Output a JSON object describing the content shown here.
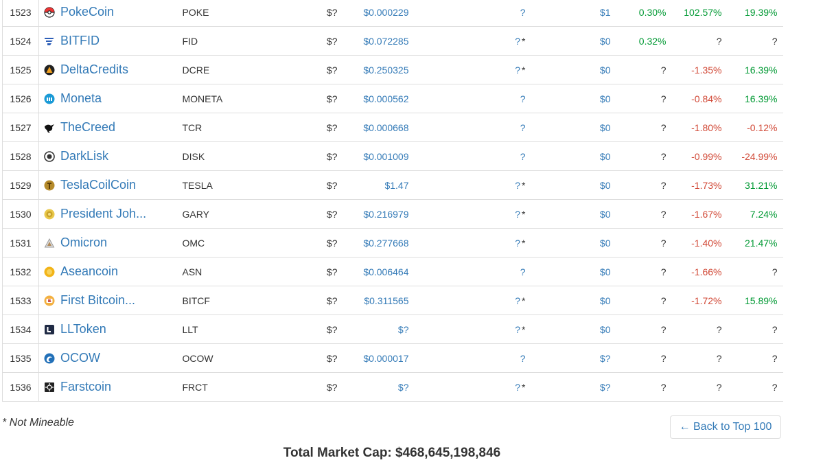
{
  "rows": [
    {
      "rank": "1523",
      "icon": "pokecoin-icon",
      "name": "PokeCoin",
      "symbol": "POKE",
      "market_cap": "$?",
      "price": "$0.000229",
      "supply": "?",
      "mineable": true,
      "volume": "$1",
      "change_1h": "0.30%",
      "change_24h": "102.57%",
      "change_7d": "19.39%"
    },
    {
      "rank": "1524",
      "icon": "bitfid-icon",
      "name": "BITFID",
      "symbol": "FID",
      "market_cap": "$?",
      "price": "$0.072285",
      "supply": "?",
      "mineable": false,
      "volume": "$0",
      "change_1h": "0.32%",
      "change_24h": "?",
      "change_7d": "?"
    },
    {
      "rank": "1525",
      "icon": "deltacredits-icon",
      "name": "DeltaCredits",
      "symbol": "DCRE",
      "market_cap": "$?",
      "price": "$0.250325",
      "supply": "?",
      "mineable": false,
      "volume": "$0",
      "change_1h": "?",
      "change_24h": "-1.35%",
      "change_7d": "16.39%"
    },
    {
      "rank": "1526",
      "icon": "moneta-icon",
      "name": "Moneta",
      "symbol": "MONETA",
      "market_cap": "$?",
      "price": "$0.000562",
      "supply": "?",
      "mineable": true,
      "volume": "$0",
      "change_1h": "?",
      "change_24h": "-0.84%",
      "change_7d": "16.39%"
    },
    {
      "rank": "1527",
      "icon": "thecreed-icon",
      "name": "TheCreed",
      "symbol": "TCR",
      "market_cap": "$?",
      "price": "$0.000668",
      "supply": "?",
      "mineable": true,
      "volume": "$0",
      "change_1h": "?",
      "change_24h": "-1.80%",
      "change_7d": "-0.12%"
    },
    {
      "rank": "1528",
      "icon": "darklisk-icon",
      "name": "DarkLisk",
      "symbol": "DISK",
      "market_cap": "$?",
      "price": "$0.001009",
      "supply": "?",
      "mineable": true,
      "volume": "$0",
      "change_1h": "?",
      "change_24h": "-0.99%",
      "change_7d": "-24.99%"
    },
    {
      "rank": "1529",
      "icon": "teslacoilcoin-icon",
      "name": "TeslaCoilCoin",
      "symbol": "TESLA",
      "market_cap": "$?",
      "price": "$1.47",
      "supply": "?",
      "mineable": false,
      "volume": "$0",
      "change_1h": "?",
      "change_24h": "-1.73%",
      "change_7d": "31.21%"
    },
    {
      "rank": "1530",
      "icon": "president-johnson-icon",
      "name": "President Joh...",
      "symbol": "GARY",
      "market_cap": "$?",
      "price": "$0.216979",
      "supply": "?",
      "mineable": false,
      "volume": "$0",
      "change_1h": "?",
      "change_24h": "-1.67%",
      "change_7d": "7.24%"
    },
    {
      "rank": "1531",
      "icon": "omicron-icon",
      "name": "Omicron",
      "symbol": "OMC",
      "market_cap": "$?",
      "price": "$0.277668",
      "supply": "?",
      "mineable": false,
      "volume": "$0",
      "change_1h": "?",
      "change_24h": "-1.40%",
      "change_7d": "21.47%"
    },
    {
      "rank": "1532",
      "icon": "aseancoin-icon",
      "name": "Aseancoin",
      "symbol": "ASN",
      "market_cap": "$?",
      "price": "$0.006464",
      "supply": "?",
      "mineable": true,
      "volume": "$0",
      "change_1h": "?",
      "change_24h": "-1.66%",
      "change_7d": "?"
    },
    {
      "rank": "1533",
      "icon": "first-bitcoin-icon",
      "name": "First Bitcoin...",
      "symbol": "BITCF",
      "market_cap": "$?",
      "price": "$0.311565",
      "supply": "?",
      "mineable": false,
      "volume": "$0",
      "change_1h": "?",
      "change_24h": "-1.72%",
      "change_7d": "15.89%"
    },
    {
      "rank": "1534",
      "icon": "lltoken-icon",
      "name": "LLToken",
      "symbol": "LLT",
      "market_cap": "$?",
      "price": "$?",
      "supply": "?",
      "mineable": false,
      "volume": "$0",
      "change_1h": "?",
      "change_24h": "?",
      "change_7d": "?"
    },
    {
      "rank": "1535",
      "icon": "ocow-icon",
      "name": "OCOW",
      "symbol": "OCOW",
      "market_cap": "$?",
      "price": "$0.000017",
      "supply": "?",
      "mineable": true,
      "volume": "$?",
      "change_1h": "?",
      "change_24h": "?",
      "change_7d": "?"
    },
    {
      "rank": "1536",
      "icon": "farstcoin-icon",
      "name": "Farstcoin",
      "symbol": "FRCT",
      "market_cap": "$?",
      "price": "$?",
      "supply": "?",
      "mineable": false,
      "volume": "$?",
      "change_1h": "?",
      "change_24h": "?",
      "change_7d": "?"
    }
  ],
  "not_mineable_marker": "*",
  "footnote": "* Not Mineable",
  "back_button_label": "← Back to Top 100",
  "total_market_cap": "Total Market Cap: $468,645,198,846",
  "colors": {
    "link": "#337ab7",
    "positive": "#009933",
    "negative": "#d14836",
    "text": "#333333",
    "border": "#dddddd"
  }
}
